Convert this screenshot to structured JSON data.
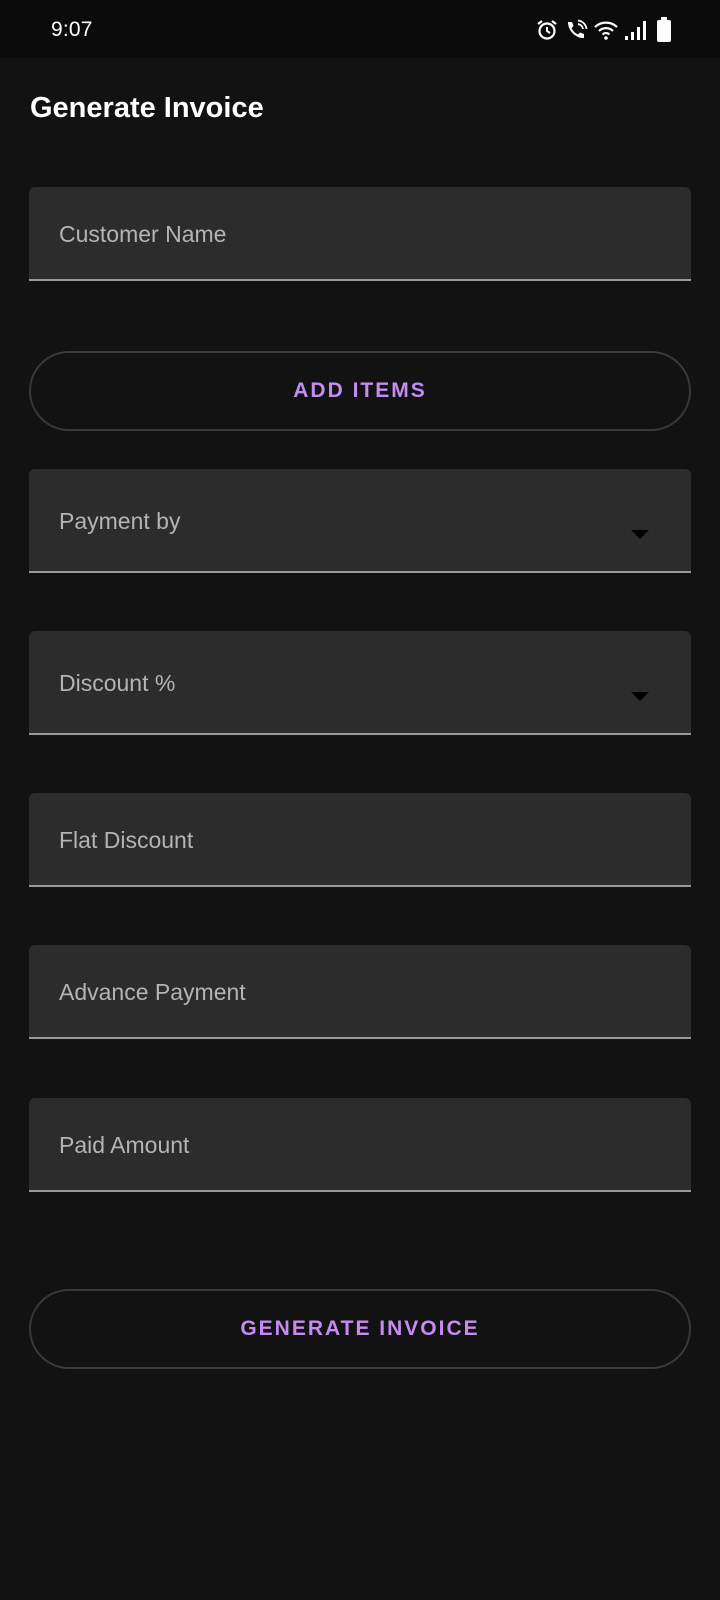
{
  "status_bar": {
    "time": "9:07",
    "icons": [
      "alarm-icon",
      "wifi-call-icon",
      "wifi-icon",
      "signal-icon",
      "battery-icon"
    ]
  },
  "screen": {
    "title": "Generate Invoice"
  },
  "form": {
    "customer_name_label": "Customer Name",
    "add_items_label": "ADD ITEMS",
    "payment_by_label": "Payment by",
    "discount_percent_label": "Discount %",
    "flat_discount_label": "Flat Discount",
    "advance_payment_label": "Advance Payment",
    "paid_amount_label": "Paid Amount",
    "generate_invoice_label": "GENERATE INVOICE"
  },
  "colors": {
    "background": "#121212",
    "field_fill": "#2c2c2c",
    "accent": "#c48cf0",
    "field_underline": "#9a9a9a"
  }
}
